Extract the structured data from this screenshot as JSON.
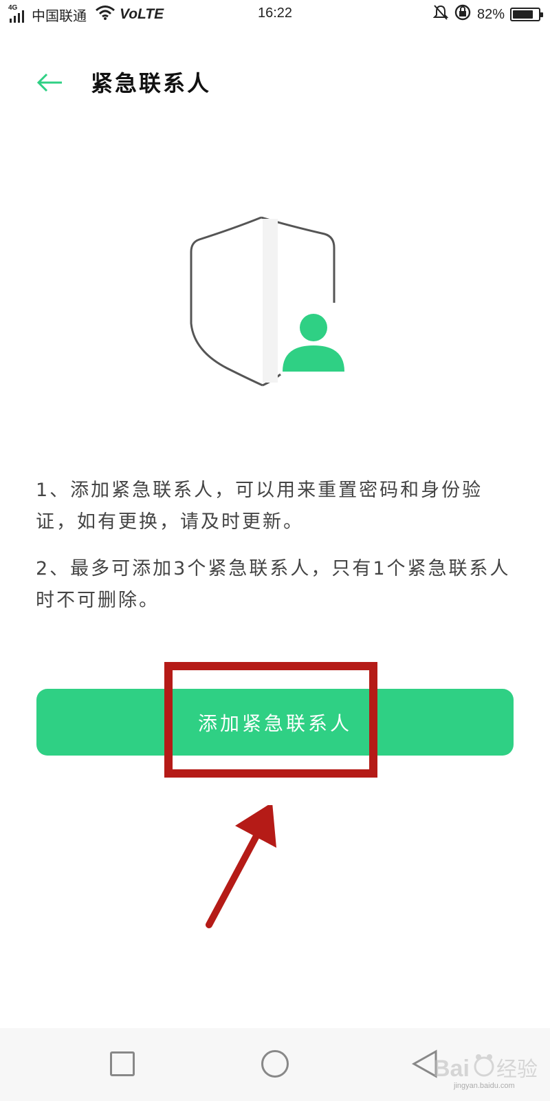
{
  "status_bar": {
    "network": "4G",
    "carrier": "中国联通",
    "volte": "VoLTE",
    "time": "16:22",
    "battery_percent": "82%",
    "battery_level": 0.82
  },
  "header": {
    "title": "紧急联系人"
  },
  "info": {
    "item1": "1、添加紧急联系人，可以用来重置密码和身份验证，如有更换，请及时更新。",
    "item2": "2、最多可添加3个紧急联系人，只有1个紧急联系人时不可删除。"
  },
  "add_button": {
    "label": "添加紧急联系人"
  },
  "colors": {
    "accent": "#2fd084",
    "annotation": "#b51b17"
  },
  "watermark": {
    "url": "jingyan.baidu.com"
  }
}
